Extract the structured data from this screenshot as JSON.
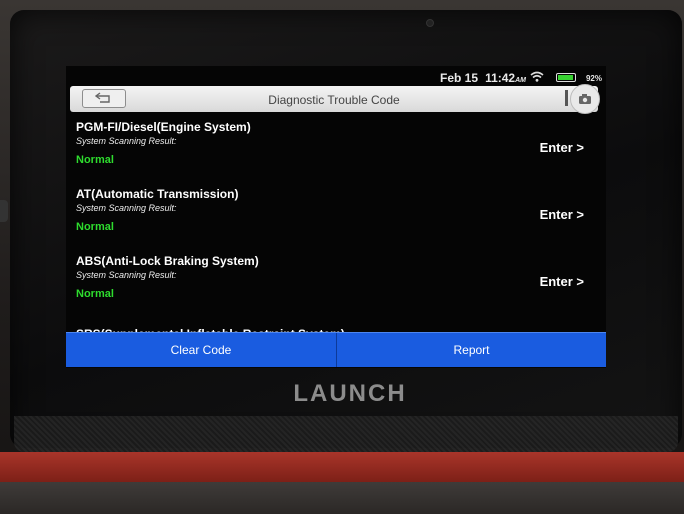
{
  "status": {
    "date": "Feb 15",
    "time": "11:42",
    "am": "AM",
    "battery": "92%",
    "battery_level": 0.92
  },
  "header": {
    "title": "Diagnostic Trouble Code"
  },
  "systems": [
    {
      "name": "PGM-FI/Diesel(Engine System)",
      "scan_label": "System Scanning Result:",
      "result": "Normal",
      "action": "Enter >"
    },
    {
      "name": "AT(Automatic Transmission)",
      "scan_label": "System Scanning Result:",
      "result": "Normal",
      "action": "Enter >"
    },
    {
      "name": "ABS(Anti-Lock Braking System)",
      "scan_label": "System Scanning Result:",
      "result": "Normal",
      "action": "Enter >"
    }
  ],
  "partial_system": "SRS(Supplemental Inflatable Restraint System)",
  "actions": {
    "clear_code": "Clear Code",
    "report": "Report"
  },
  "device": {
    "brand": "LAUNCH"
  },
  "icons": {
    "back": "back-arrow-icon",
    "camera": "camera-icon",
    "wifi": "wifi-icon",
    "battery": "battery-icon"
  },
  "colors": {
    "normal": "#2edc2e",
    "action_bar": "#1a5ce0"
  }
}
